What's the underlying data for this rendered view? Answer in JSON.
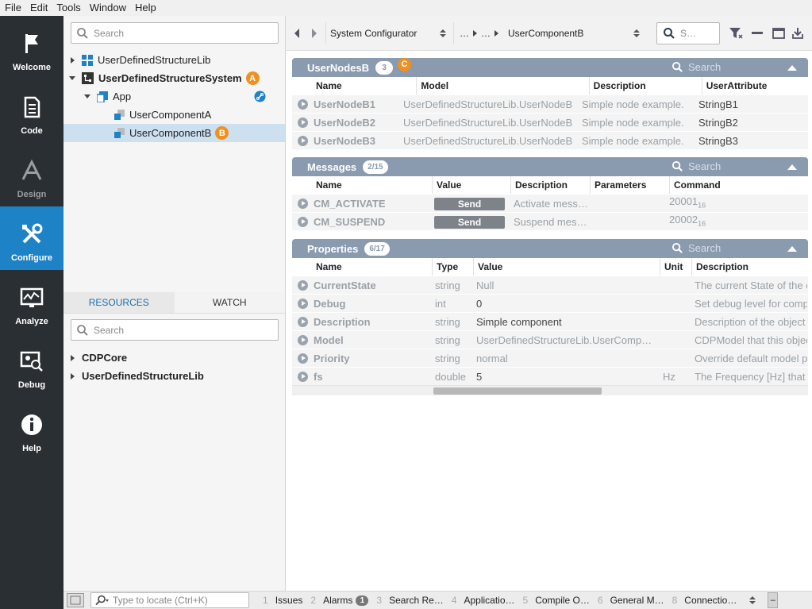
{
  "menu": [
    "File",
    "Edit",
    "Tools",
    "Window",
    "Help"
  ],
  "activity": [
    {
      "label": "Welcome",
      "icon": "flag-icon"
    },
    {
      "label": "Code",
      "icon": "document-icon"
    },
    {
      "label": "Design",
      "icon": "design-icon"
    },
    {
      "label": "Configure",
      "icon": "tools-icon"
    },
    {
      "label": "Analyze",
      "icon": "chart-monitor-icon"
    },
    {
      "label": "Debug",
      "icon": "debug-monitor-icon"
    },
    {
      "label": "Help",
      "icon": "info-icon"
    }
  ],
  "tree": {
    "search_placeholder": "Search",
    "items": [
      {
        "label": "UserDefinedStructureLib"
      },
      {
        "label": "UserDefinedStructureSystem",
        "badge": "A"
      },
      {
        "label": "App"
      },
      {
        "label": "UserComponentA"
      },
      {
        "label": "UserComponentB",
        "badge": "B"
      }
    ]
  },
  "resources": {
    "tabs": [
      "RESOURCES",
      "WATCH"
    ],
    "search_placeholder": "Search",
    "items": [
      "CDPCore",
      "UserDefinedStructureLib"
    ]
  },
  "toolbar": {
    "configurator": "System Configurator",
    "breadcrumb_ellipsis": "…",
    "breadcrumb_target": "UserComponentB",
    "search_placeholder": "S…"
  },
  "nodes": {
    "title": "UserNodesB",
    "count": "3",
    "badge": "C",
    "search": "Search",
    "columns": [
      "Name",
      "Model",
      "Description",
      "UserAttribute"
    ],
    "rows": [
      [
        "UserNodeB1",
        "UserDefinedStructureLib.UserNodeB",
        "Simple node example.",
        "StringB1"
      ],
      [
        "UserNodeB2",
        "UserDefinedStructureLib.UserNodeB",
        "Simple node example.",
        "StringB2"
      ],
      [
        "UserNodeB3",
        "UserDefinedStructureLib.UserNodeB",
        "Simple node example.",
        "StringB3"
      ]
    ]
  },
  "messages": {
    "title": "Messages",
    "count": "2/15",
    "search": "Search",
    "columns": [
      "Name",
      "Value",
      "Description",
      "Parameters",
      "Command"
    ],
    "rows": [
      {
        "name": "CM_ACTIVATE",
        "value": "Send",
        "desc": "Activate mess…",
        "params": "",
        "cmd": "20001",
        "cmd_sub": "16"
      },
      {
        "name": "CM_SUSPEND",
        "value": "Send",
        "desc": "Suspend mes…",
        "params": "",
        "cmd": "20002",
        "cmd_sub": "16"
      }
    ]
  },
  "properties": {
    "title": "Properties",
    "count": "6/17",
    "search": "Search",
    "columns": [
      "Name",
      "Type",
      "Value",
      "Unit",
      "Description"
    ],
    "rows": [
      [
        "CurrentState",
        "string",
        "Null",
        "",
        "The current State of the c"
      ],
      [
        "Debug",
        "int",
        "0",
        "",
        "Set debug level for compo"
      ],
      [
        "Description",
        "string",
        "Simple component",
        "",
        "Description of the object"
      ],
      [
        "Model",
        "string",
        "UserDefinedStructureLib.UserComp…",
        "",
        "CDPModel that this objec"
      ],
      [
        "Priority",
        "string",
        "normal",
        "",
        "Override default model pr"
      ],
      [
        "fs",
        "double",
        "5",
        "Hz",
        "The Frequency [Hz] that t"
      ]
    ]
  },
  "status": {
    "locate_placeholder": "Type to locate (Ctrl+K)",
    "tabs": [
      {
        "num": "1",
        "label": "Issues"
      },
      {
        "num": "2",
        "label": "Alarms",
        "pill": "1"
      },
      {
        "num": "3",
        "label": "Search Re…"
      },
      {
        "num": "4",
        "label": "Applicatio…"
      },
      {
        "num": "5",
        "label": "Compile O…"
      },
      {
        "num": "6",
        "label": "General M…"
      },
      {
        "num": "8",
        "label": "Connectio…"
      }
    ],
    "minimize": "–"
  }
}
